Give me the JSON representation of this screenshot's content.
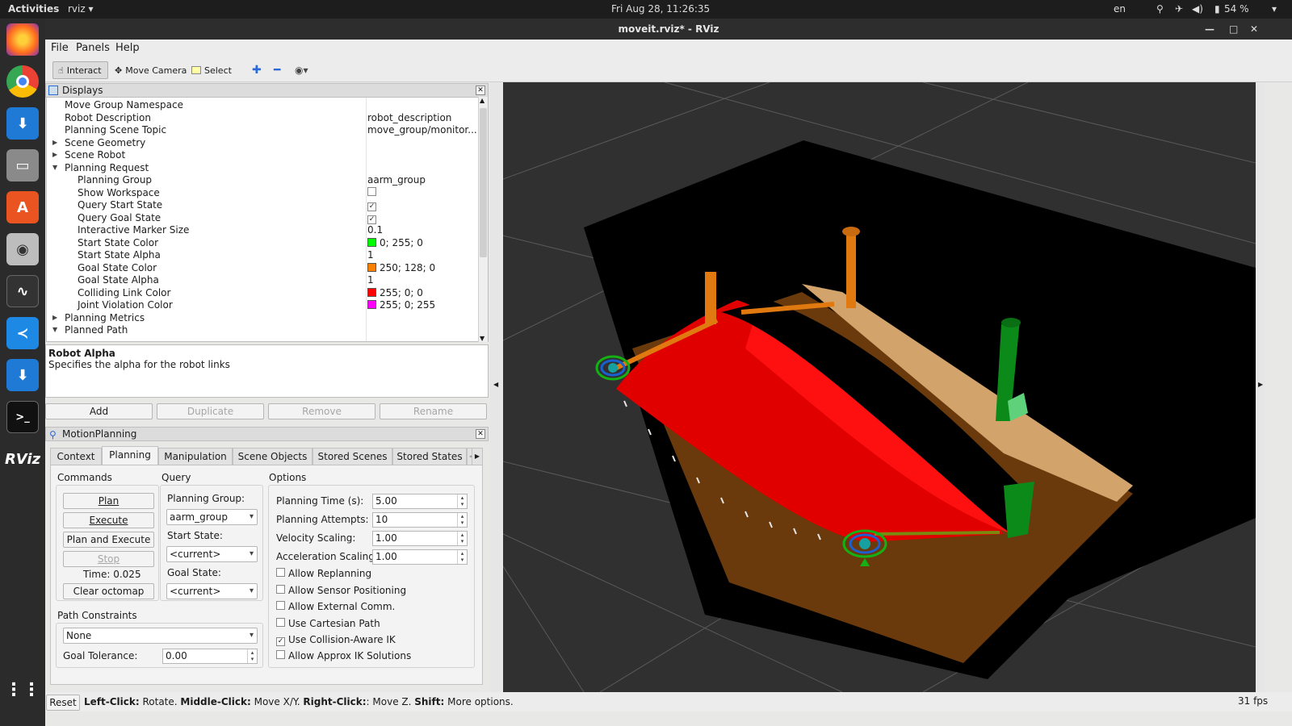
{
  "topbar": {
    "activities": "Activities",
    "app": "rviz",
    "clock": "Fri Aug 28, 11:26:35",
    "lang": "en",
    "battery": "54 %"
  },
  "window": {
    "title": "moveit.rviz* - RViz"
  },
  "menu": [
    "File",
    "Panels",
    "Help"
  ],
  "toolbar": {
    "interact": "Interact",
    "move_camera": "Move Camera",
    "select": "Select"
  },
  "displays": {
    "title": "Displays",
    "rows": [
      {
        "key": "Move Group Namespace",
        "value": ""
      },
      {
        "key": "Robot Description",
        "value": "robot_description"
      },
      {
        "key": "Planning Scene Topic",
        "value": "move_group/monitor..."
      },
      {
        "key": "Scene Geometry",
        "value": ""
      },
      {
        "key": "Scene Robot",
        "value": ""
      },
      {
        "key": "Planning Request",
        "value": ""
      },
      {
        "key": "Planning Group",
        "value": "aarm_group"
      },
      {
        "key": "Show Workspace",
        "value": ""
      },
      {
        "key": "Query Start State",
        "value": ""
      },
      {
        "key": "Query Goal State",
        "value": ""
      },
      {
        "key": "Interactive Marker Size",
        "value": "0.1"
      },
      {
        "key": "Start State Color",
        "value": "0; 255; 0",
        "color": "#00ff00"
      },
      {
        "key": "Start State Alpha",
        "value": "1"
      },
      {
        "key": "Goal State Color",
        "value": "250; 128; 0",
        "color": "#fa8000"
      },
      {
        "key": "Goal State Alpha",
        "value": "1"
      },
      {
        "key": "Colliding Link Color",
        "value": "255; 0; 0",
        "color": "#ff0000"
      },
      {
        "key": "Joint Violation Color",
        "value": "255; 0; 255",
        "color": "#ff00ff"
      },
      {
        "key": "Planning Metrics",
        "value": ""
      },
      {
        "key": "Planned Path",
        "value": ""
      }
    ],
    "desc_title": "Robot Alpha",
    "desc_text": "Specifies the alpha for the robot links",
    "buttons": {
      "add": "Add",
      "duplicate": "Duplicate",
      "remove": "Remove",
      "rename": "Rename"
    }
  },
  "motion": {
    "title": "MotionPlanning",
    "tabs": [
      "Context",
      "Planning",
      "Manipulation",
      "Scene Objects",
      "Stored Scenes",
      "Stored States"
    ],
    "commands_label": "Commands",
    "plan": "Plan",
    "execute": "Execute",
    "plan_execute": "Plan and Execute",
    "stop": "Stop",
    "time": "Time: 0.025",
    "clear_octomap": "Clear octomap",
    "query_label": "Query",
    "planning_group_label": "Planning Group:",
    "planning_group": "aarm_group",
    "start_state_label": "Start State:",
    "start_state": "<current>",
    "goal_state_label": "Goal State:",
    "goal_state": "<current>",
    "options_label": "Options",
    "planning_time_label": "Planning Time (s):",
    "planning_time": "5.00",
    "planning_attempts_label": "Planning Attempts:",
    "planning_attempts": "10",
    "velocity_label": "Velocity Scaling:",
    "velocity": "1.00",
    "accel_label": "Acceleration Scaling:",
    "accel": "1.00",
    "checks": [
      "Allow Replanning",
      "Allow Sensor Positioning",
      "Allow External Comm.",
      "Use Cartesian Path",
      "Use Collision-Aware IK",
      "Allow Approx IK Solutions"
    ],
    "path_constraints_label": "Path Constraints",
    "path_constraints": "None",
    "goal_tol_label": "Goal Tolerance:",
    "goal_tol": "0.00"
  },
  "status": {
    "reset": "Reset",
    "lc": "Left-Click:",
    "lc_t": " Rotate. ",
    "mc": "Middle-Click:",
    "mc_t": " Move X/Y. ",
    "rc": "Right-Click:",
    "rc_t": ": Move Z. ",
    "sh": "Shift:",
    "sh_t": " More options.",
    "fps": "31 fps"
  }
}
